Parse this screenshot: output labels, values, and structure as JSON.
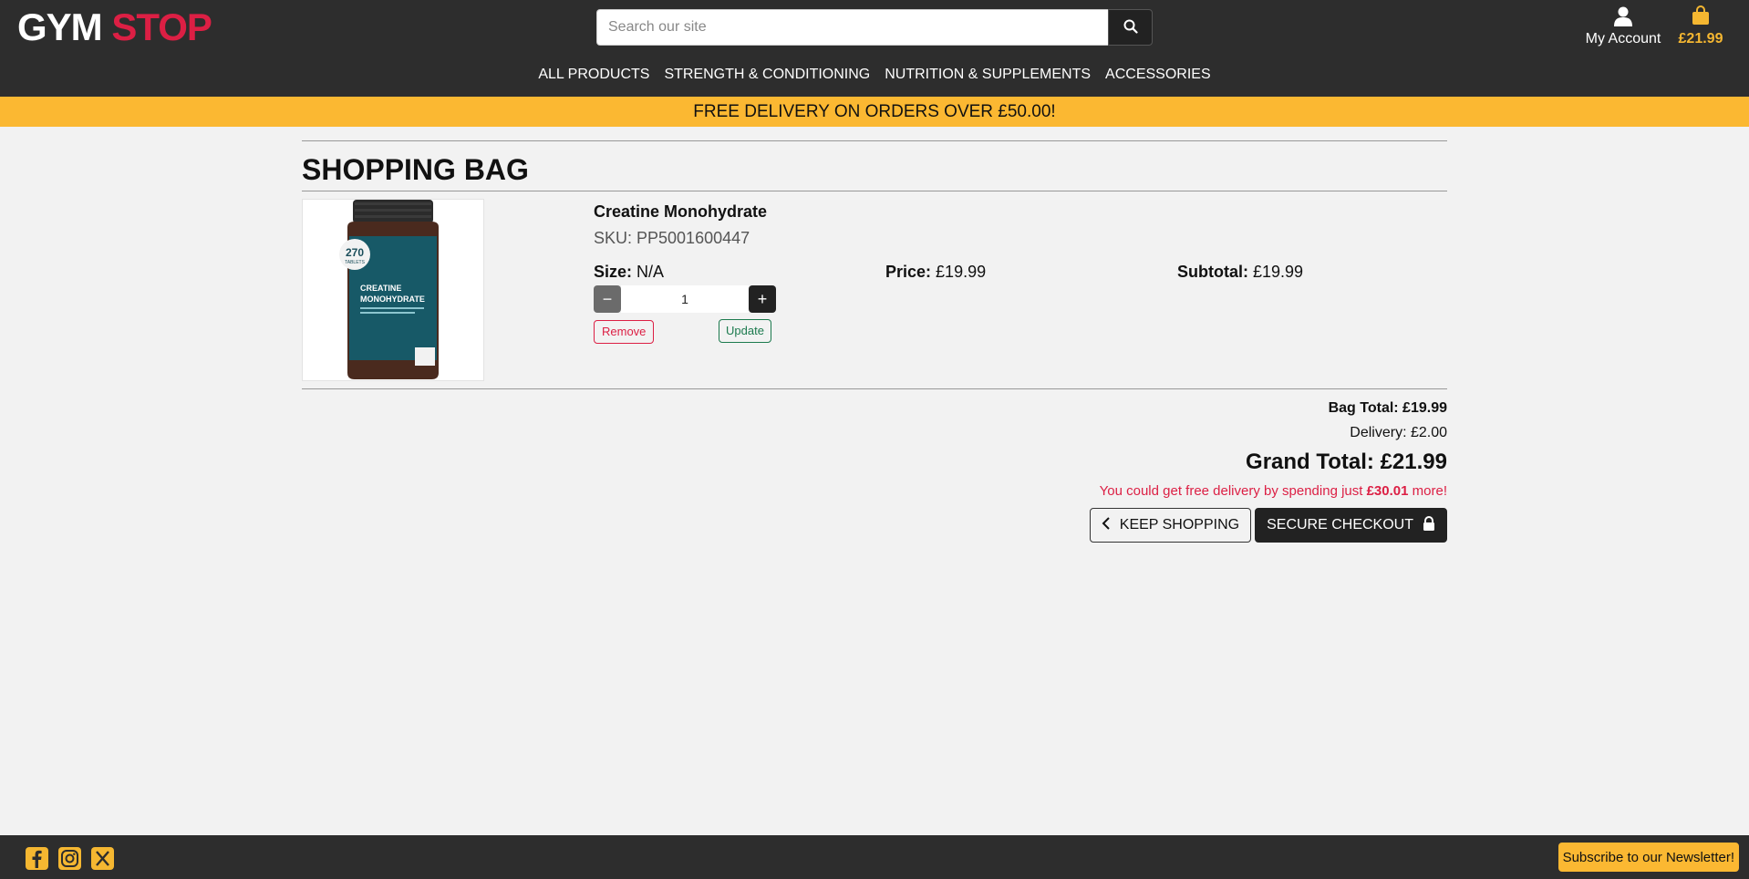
{
  "header": {
    "logo_part1": "GYM",
    "logo_part2": "STOP",
    "search_placeholder": "Search our site",
    "account_label": "My Account",
    "bag_total": "£21.99"
  },
  "nav": [
    "ALL PRODUCTS",
    "STRENGTH & CONDITIONING",
    "NUTRITION & SUPPLEMENTS",
    "ACCESSORIES"
  ],
  "banner": "FREE DELIVERY ON ORDERS OVER £50.00!",
  "page_title": "SHOPPING BAG",
  "item": {
    "name": "Creatine Monohydrate",
    "sku": "SKU: PP5001600447",
    "size_label": "Size:",
    "size_value": "N/A",
    "price_label": "Price:",
    "price_value": "£19.99",
    "subtotal_label": "Subtotal:",
    "subtotal_value": "£19.99",
    "quantity": "1",
    "minus": "−",
    "plus": "+",
    "remove_label": "Remove",
    "update_label": "Update",
    "image_badge_top": "270",
    "image_badge_sub": "TABLETS",
    "image_brand": "Creatine Monohydrate"
  },
  "totals": {
    "bag_total": "Bag Total: £19.99",
    "delivery": "Delivery: £2.00",
    "grand_total": "Grand Total: £21.99",
    "free_msg_pre": "You could get free delivery by spending just ",
    "free_msg_amount": "£30.01",
    "free_msg_post": " more!"
  },
  "actions": {
    "keep_shopping": "KEEP SHOPPING",
    "secure_checkout": "SECURE CHECKOUT"
  },
  "footer": {
    "newsletter_label": "Subscribe to our Newsletter!",
    "social_icons": [
      "facebook-icon",
      "instagram-icon",
      "x-icon"
    ]
  },
  "colors": {
    "header_bg": "#2d2d2d",
    "brand_red": "#dc1f44",
    "banner_yellow": "#fbb832",
    "update_green": "#1c7a4e"
  }
}
